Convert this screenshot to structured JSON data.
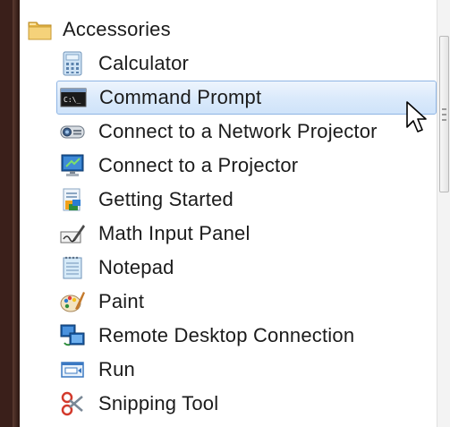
{
  "menu": {
    "folder": {
      "label": "Accessories",
      "icon": "folder-icon"
    },
    "items": [
      {
        "label": "Calculator",
        "icon": "calculator-icon",
        "selected": false
      },
      {
        "label": "Command Prompt",
        "icon": "command-prompt-icon",
        "selected": true
      },
      {
        "label": "Connect to a Network Projector",
        "icon": "network-projector-icon",
        "selected": false
      },
      {
        "label": "Connect to a Projector",
        "icon": "projector-icon",
        "selected": false
      },
      {
        "label": "Getting Started",
        "icon": "getting-started-icon",
        "selected": false
      },
      {
        "label": "Math Input Panel",
        "icon": "math-input-icon",
        "selected": false
      },
      {
        "label": "Notepad",
        "icon": "notepad-icon",
        "selected": false
      },
      {
        "label": "Paint",
        "icon": "paint-icon",
        "selected": false
      },
      {
        "label": "Remote Desktop Connection",
        "icon": "remote-desktop-icon",
        "selected": false
      },
      {
        "label": "Run",
        "icon": "run-icon",
        "selected": false
      },
      {
        "label": "Snipping Tool",
        "icon": "snipping-tool-icon",
        "selected": false
      }
    ]
  },
  "colors": {
    "selection_bg": "#dbeafb",
    "selection_border": "#8fb5e4",
    "text": "#1b1b1b",
    "frame": "#3a1f1a"
  }
}
